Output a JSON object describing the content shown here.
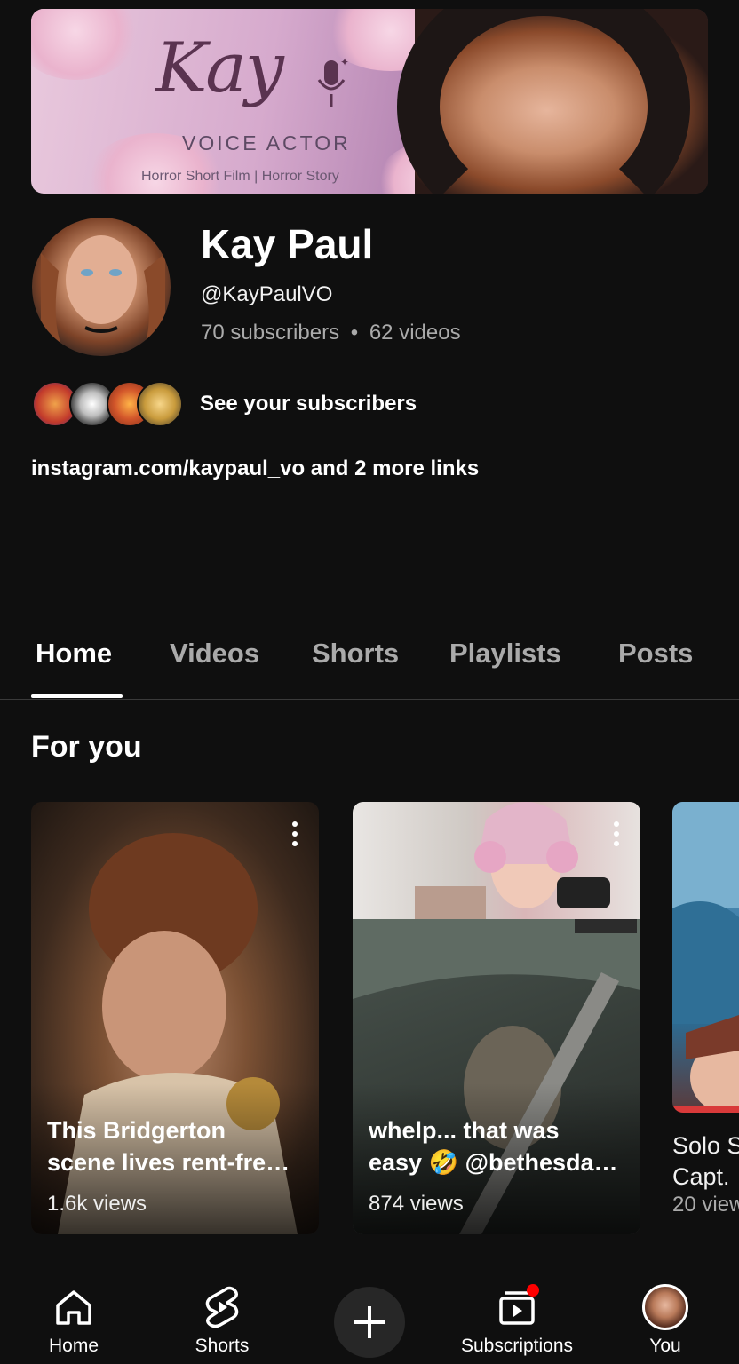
{
  "banner": {
    "logo_text": "Kay",
    "role": "VOICE ACTOR",
    "tagline": "Horror Short Film | Horror Story"
  },
  "channel": {
    "name": "Kay Paul",
    "handle": "@KayPaulVO",
    "subscribers": "70 subscribers",
    "separator": "•",
    "videos": "62 videos"
  },
  "subscribers_link": "See your subscribers",
  "links": {
    "url": "instagram.com/kaypaul_vo",
    "more": "and 2 more links"
  },
  "tabs": [
    {
      "label": "Home",
      "active": true
    },
    {
      "label": "Videos",
      "active": false
    },
    {
      "label": "Shorts",
      "active": false
    },
    {
      "label": "Playlists",
      "active": false
    },
    {
      "label": "Posts",
      "active": false
    }
  ],
  "section_title": "For you",
  "cards": [
    {
      "title_line1": "This Bridgerton",
      "title_line2": "scene lives rent-fre…",
      "views": "1.6k views"
    },
    {
      "title_line1": "whelp... that was",
      "title_line2": "easy 🤣 @bethesda…",
      "views": "874 views"
    },
    {
      "title_line1": "Solo S",
      "title_line2": "Capt.",
      "views": "20 view"
    }
  ],
  "bottom_nav": [
    {
      "label": "Home",
      "icon": "home-icon"
    },
    {
      "label": "Shorts",
      "icon": "shorts-icon"
    },
    {
      "label": "",
      "icon": "plus-icon"
    },
    {
      "label": "Subscriptions",
      "icon": "subscriptions-icon"
    },
    {
      "label": "You",
      "icon": "avatar"
    }
  ],
  "colors": {
    "background": "#0f0f0f",
    "secondary_text": "#aaaaaa",
    "notification_dot": "#ff0000"
  }
}
